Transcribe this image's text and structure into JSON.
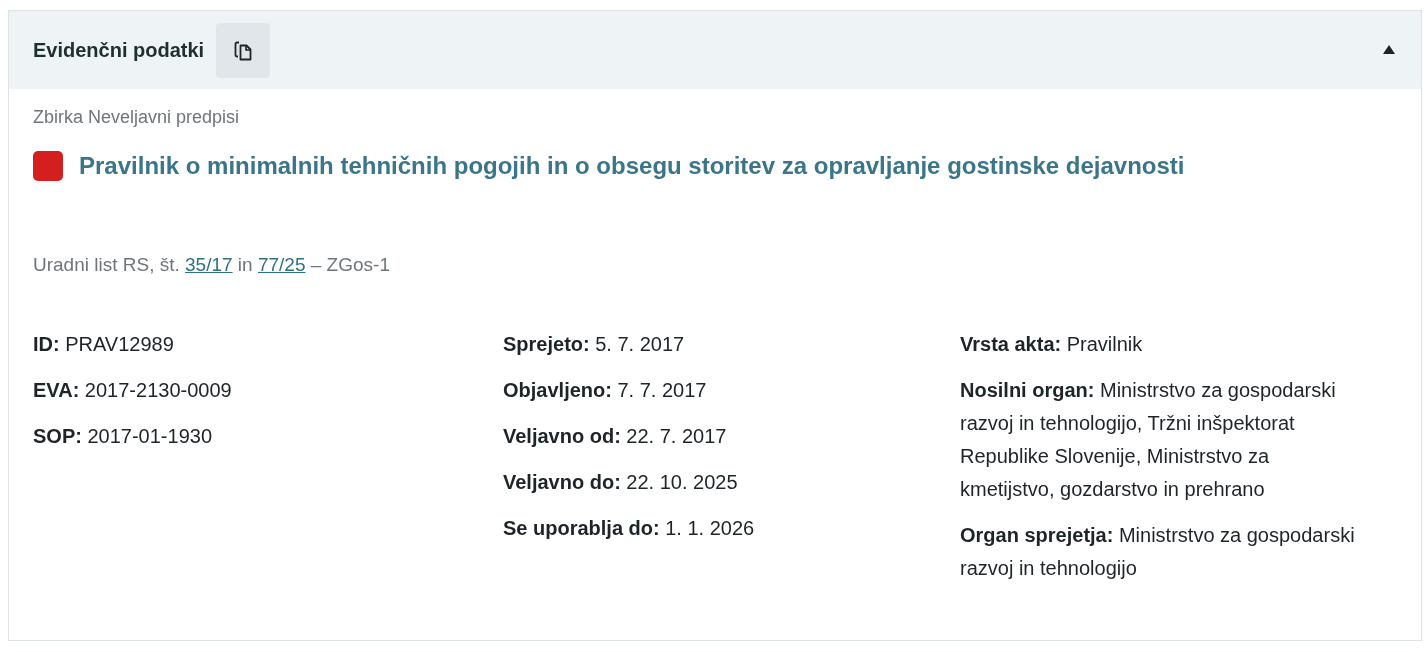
{
  "panel": {
    "title": "Evidenčni podatki",
    "expanded": true
  },
  "collection": "Zbirka Neveljavni predpisi",
  "document": {
    "title": "Pravilnik o minimalnih tehničnih pogojih in o obsegu storitev za opravljanje gostinske dejavnosti"
  },
  "gazette": [
    {
      "kind": "text",
      "text": "Uradni list RS, št. "
    },
    {
      "kind": "link",
      "text": "35/17"
    },
    {
      "kind": "text",
      "text": " in "
    },
    {
      "kind": "link",
      "text": "77/25"
    },
    {
      "kind": "text",
      "text": " – ZGos-1"
    }
  ],
  "columns": [
    {
      "fields": [
        {
          "label": "ID:",
          "value": "PRAV12989"
        },
        {
          "label": "EVA:",
          "value": "2017-2130-0009"
        },
        {
          "label": "SOP:",
          "value": "2017-01-1930"
        }
      ]
    },
    {
      "fields": [
        {
          "label": "Sprejeto:",
          "value": "5. 7. 2017"
        },
        {
          "label": "Objavljeno:",
          "value": "7. 7. 2017"
        },
        {
          "label": "Veljavno od:",
          "value": "22. 7. 2017"
        },
        {
          "label": "Veljavno do:",
          "value": "22. 10. 2025"
        },
        {
          "label": "Se uporablja do:",
          "value": "1. 1. 2026"
        }
      ]
    },
    {
      "fields": [
        {
          "label": "Vrsta akta:",
          "value": "Pravilnik"
        },
        {
          "label": "Nosilni organ:",
          "value": "Ministrstvo za gospodarski razvoj in tehnologijo, Tržni inšpektorat Republike Slovenije, Ministrstvo za kmetijstvo, gozdarstvo in prehrano"
        },
        {
          "label": "Organ sprejetja:",
          "value": "Ministrstvo za gospodarski razvoj in tehnologijo"
        }
      ]
    }
  ]
}
